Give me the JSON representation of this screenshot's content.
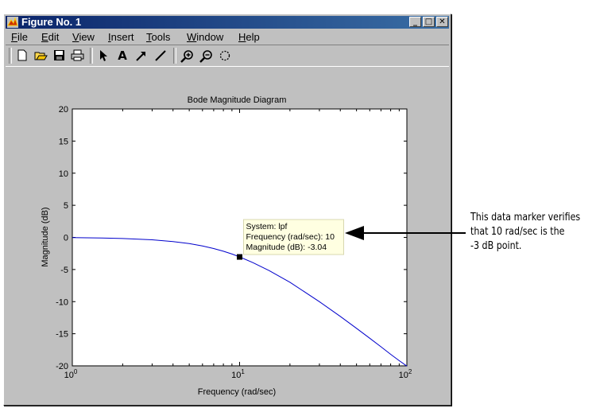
{
  "window": {
    "title": "Figure No. 1",
    "minimize_glyph": "_",
    "maximize_glyph": "□",
    "close_glyph": "✕"
  },
  "menu": {
    "items": [
      {
        "ul": "F",
        "rest": "ile"
      },
      {
        "ul": "E",
        "rest": "dit"
      },
      {
        "ul": "V",
        "rest": "iew"
      },
      {
        "ul": "I",
        "rest": "nsert"
      },
      {
        "ul": "T",
        "rest": "ools"
      },
      {
        "ul": "W",
        "rest": "indow"
      },
      {
        "ul": "H",
        "rest": "elp"
      }
    ]
  },
  "toolbar": {
    "icons": [
      "new-file-icon",
      "open-folder-icon",
      "save-icon",
      "print-icon",
      "pointer-arrow-icon",
      "insert-text-icon",
      "insert-arrow-icon",
      "insert-line-icon",
      "zoom-in-icon",
      "zoom-out-icon",
      "rotate-icon"
    ],
    "text_glyph": "A"
  },
  "annotation": {
    "lines": [
      "This data marker verifies",
      "that 10 rad/sec is the",
      "-3 dB point."
    ]
  },
  "chart_data": {
    "type": "line",
    "title": "Bode Magnitude Diagram",
    "xlabel": "Frequency (rad/sec)",
    "ylabel": "Magnitude (dB)",
    "xscale": "log",
    "xlim": [
      1,
      100
    ],
    "ylim": [
      -20,
      20
    ],
    "x_ticks": [
      {
        "base": "10",
        "exp": "0"
      },
      {
        "base": "10",
        "exp": "1"
      },
      {
        "base": "10",
        "exp": "2"
      }
    ],
    "y_ticks": [
      "20",
      "15",
      "10",
      "5",
      "0",
      "-5",
      "-10",
      "-15",
      "-20"
    ],
    "series": [
      {
        "color": "#0000cc",
        "x": [
          1,
          1.5,
          2,
          3,
          4,
          5,
          6,
          7,
          8,
          9,
          10,
          12,
          15,
          20,
          30,
          40,
          50,
          60,
          70,
          80,
          90,
          100
        ],
        "y": [
          -0.04,
          -0.1,
          -0.17,
          -0.37,
          -0.64,
          -0.97,
          -1.34,
          -1.73,
          -2.15,
          -2.59,
          -3.04,
          -3.93,
          -5.16,
          -6.99,
          -10.0,
          -12.3,
          -14.15,
          -15.7,
          -17.03,
          -18.2,
          -19.2,
          -20.04
        ]
      }
    ],
    "marker": {
      "x": 10,
      "y": -3.04,
      "datatip": [
        "System: lpf",
        "Frequency (rad/sec): 10",
        "Magnitude (dB): -3.04"
      ]
    },
    "grid": false
  }
}
